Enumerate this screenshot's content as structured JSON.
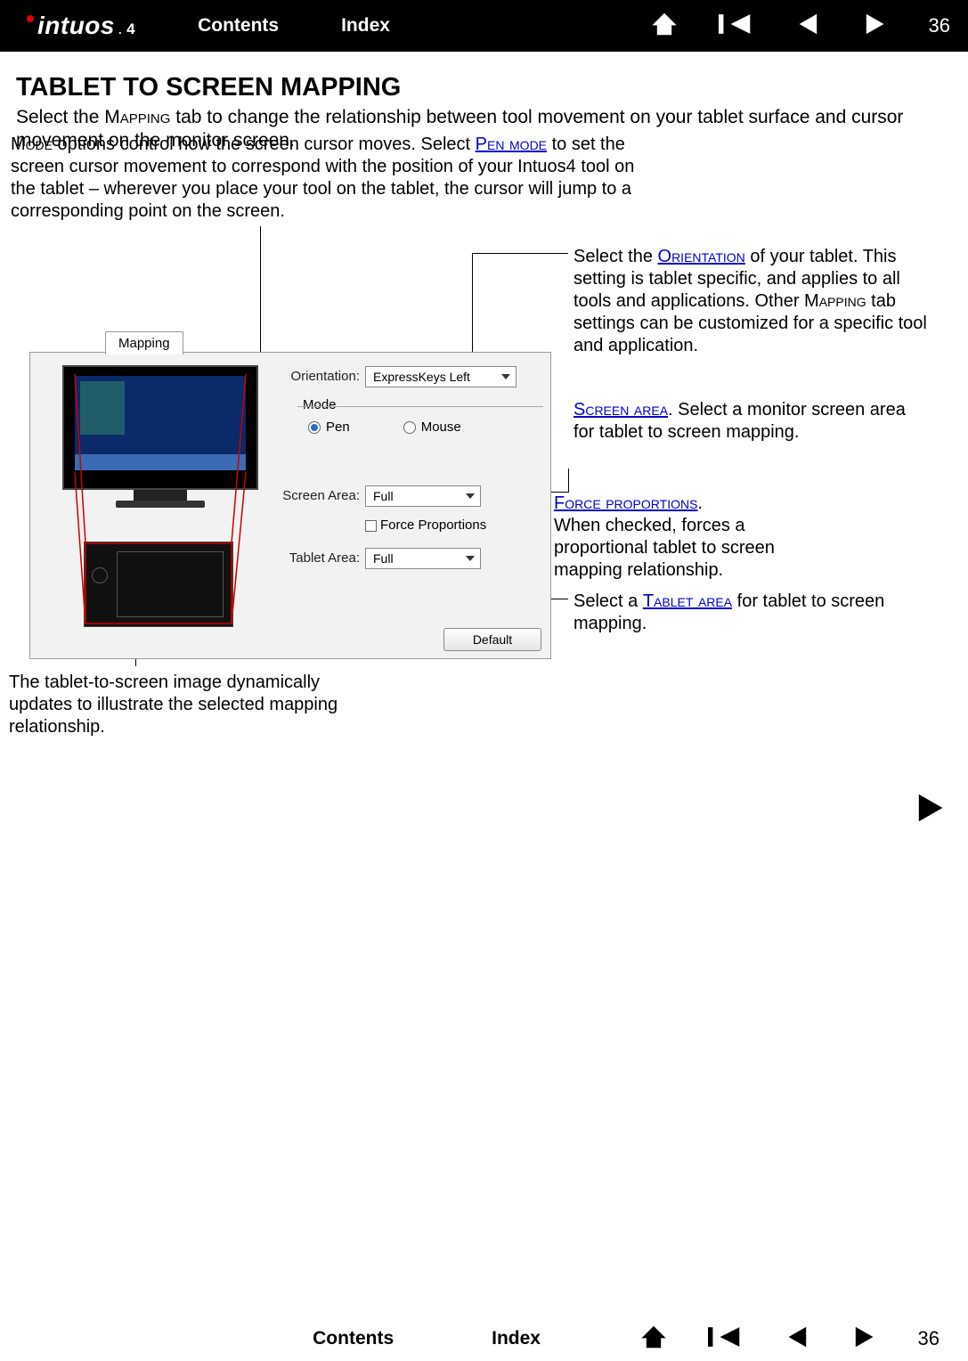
{
  "nav": {
    "brand_main": "intuos",
    "brand_dot": ".",
    "brand_4": "4",
    "contents": "Contents",
    "index": "Index",
    "page_number": "36"
  },
  "heading": "TABLET TO SCREEN MAPPING",
  "intro_pre": "Select the ",
  "intro_mapping": "Mapping",
  "intro_post": " tab to change the relationship between tool movement on your tablet surface and cursor movement on the monitor screen.",
  "callout_mode_1": "Mode",
  "callout_mode_2": " options control how the screen cursor moves.  Select ",
  "callout_mode_link": "Pen mode",
  "callout_mode_3": " to set the screen cursor movement to correspond with the position of your Intuos4 tool on the tablet – wherever you place your tool on the tablet, the cursor will jump to a corresponding point on the screen.",
  "callout_orientation_1": "Select the ",
  "callout_orientation_link": "Orientation",
  "callout_orientation_2": " of your tablet.  This setting is tablet specific, and applies to all tools and applications.  Other ",
  "callout_orientation_sc": "Mapping",
  "callout_orientation_3": " tab settings can be customized for a specific tool and application.",
  "callout_screenarea_link": "Screen area",
  "callout_screenarea_text": ".  Select a monitor screen area for tablet to screen mapping.",
  "callout_force_link": "Force proportions",
  "callout_force_text_1": ".",
  "callout_force_text_2": "When checked, forces a proportional tablet to screen mapping relationship.",
  "callout_tabletarea_1": "Select a ",
  "callout_tabletarea_link": "Tablet area",
  "callout_tabletarea_2": " for tablet to screen mapping.",
  "callout_image": "The tablet-to-screen image dynamically updates to illustrate the selected mapping relationship.",
  "panel": {
    "tab": "Mapping",
    "orientation_label": "Orientation:",
    "orientation_value": "ExpressKeys Left",
    "mode_label": "Mode",
    "mode_pen": "Pen",
    "mode_mouse": "Mouse",
    "screen_area_label": "Screen Area:",
    "screen_area_value": "Full",
    "force_label": "Force Proportions",
    "tablet_area_label": "Tablet Area:",
    "tablet_area_value": "Full",
    "default_btn": "Default"
  }
}
